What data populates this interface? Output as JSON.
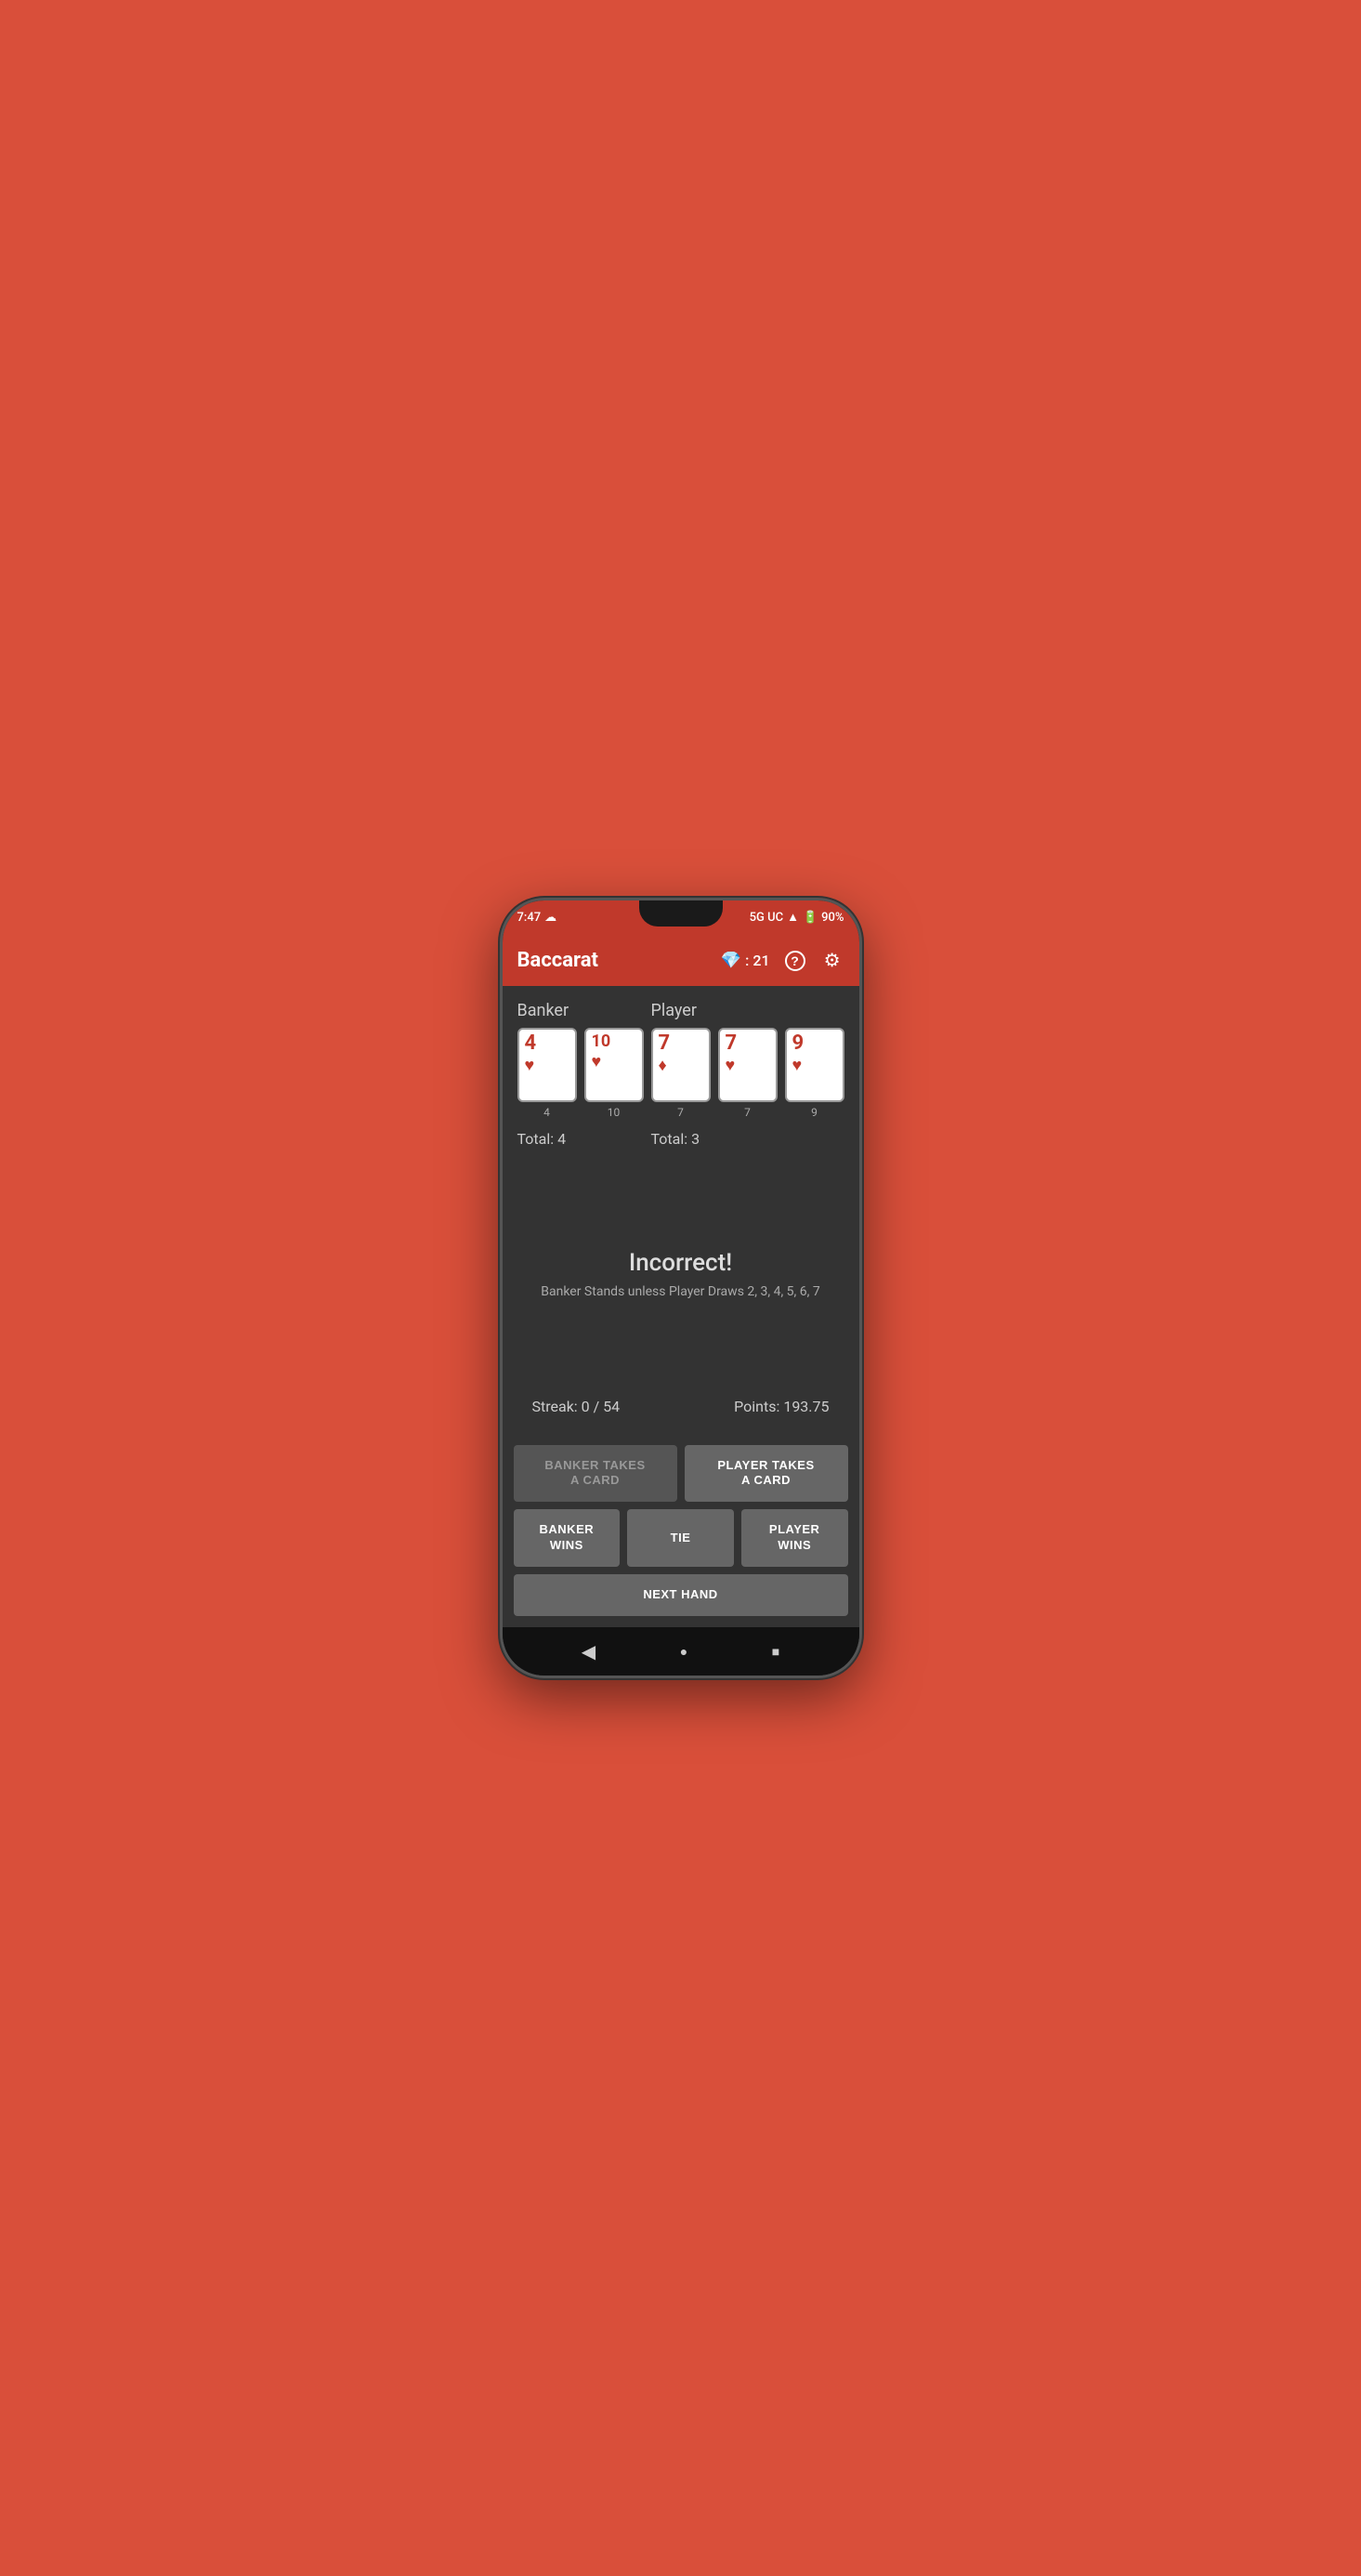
{
  "status_bar": {
    "time": "7:47",
    "network": "5G UC",
    "battery": "90%",
    "weather_icon": "☁"
  },
  "app_bar": {
    "title": "Baccarat",
    "gem_count": "21",
    "help_icon": "?",
    "settings_icon": "⚙"
  },
  "banker": {
    "label": "Banker",
    "cards": [
      {
        "value": "4",
        "suit": "♥",
        "suit_color": "red",
        "number": "4"
      },
      {
        "value": "10",
        "suit": "♥",
        "suit_color": "red",
        "number": "10"
      }
    ],
    "total_label": "Total: 4"
  },
  "player": {
    "label": "Player",
    "cards": [
      {
        "value": "7",
        "suit": "♦",
        "suit_color": "red",
        "number": "7"
      },
      {
        "value": "7",
        "suit": "♥",
        "suit_color": "red",
        "number": "7"
      },
      {
        "value": "9",
        "suit": "♥",
        "suit_color": "red",
        "number": "9"
      }
    ],
    "total_label": "Total: 3"
  },
  "message": {
    "title": "Incorrect!",
    "subtitle": "Banker Stands unless Player Draws 2, 3, 4, 5, 6, 7"
  },
  "stats": {
    "streak": "Streak: 0 / 54",
    "points": "Points: 193.75"
  },
  "buttons": {
    "banker_takes_card": "BANKER TAKES\nA CARD",
    "player_takes_card": "PLAYER TAKES\nA CARD",
    "banker_wins": "BANKER\nWINS",
    "tie": "TIE",
    "player_wins": "PLAYER\nWINS",
    "next_hand": "NEXT HAND"
  },
  "nav": {
    "back": "◀",
    "home": "●",
    "square": "■"
  }
}
